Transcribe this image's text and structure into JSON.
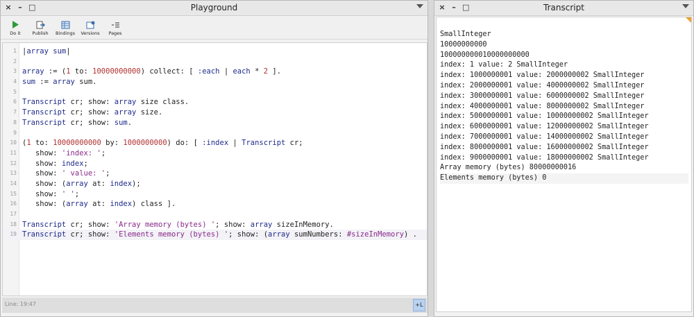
{
  "playground": {
    "title": "Playground",
    "controls": {
      "close": "×",
      "minimize": "–",
      "maximize": "□"
    },
    "toolbar": [
      {
        "label": "Do it",
        "icon": "play-icon"
      },
      {
        "label": "Publish",
        "icon": "publish-icon"
      },
      {
        "label": "Bindings",
        "icon": "bindings-icon"
      },
      {
        "label": "Versions",
        "icon": "versions-icon"
      },
      {
        "label": "Pages",
        "icon": "pages-icon"
      }
    ],
    "line_numbers": [
      "1",
      "2",
      "3",
      "4",
      "5",
      "6",
      "7",
      "8",
      "9",
      "10",
      "11",
      "12",
      "13",
      "14",
      "15",
      "16",
      "17",
      "18",
      "19"
    ],
    "status": {
      "position": "Line: 19:47",
      "toggle": "+L"
    }
  },
  "transcript": {
    "title": "Transcript",
    "controls": {
      "close": "×",
      "minimize": "–",
      "maximize": "□"
    },
    "lines": [
      "SmallInteger",
      "10000000000",
      "100000000010000000000",
      "index: 1 value: 2 SmallInteger",
      "index: 1000000001 value: 2000000002 SmallInteger",
      "index: 2000000001 value: 4000000002 SmallInteger",
      "index: 3000000001 value: 6000000002 SmallInteger",
      "index: 4000000001 value: 8000000002 SmallInteger",
      "index: 5000000001 value: 10000000002 SmallInteger",
      "index: 6000000001 value: 12000000002 SmallInteger",
      "index: 7000000001 value: 14000000002 SmallInteger",
      "index: 8000000001 value: 16000000002 SmallInteger",
      "index: 9000000001 value: 18000000002 SmallInteger",
      "Array memory (bytes) 80000000016",
      "Elements memory (bytes) 0"
    ]
  },
  "code": {
    "l1": {
      "a": "|",
      "b": "array sum",
      "c": "|"
    },
    "l3": {
      "a": "array",
      "b": " := (",
      "c": "1",
      "d": " to: ",
      "e": "10000000000",
      "f": ") collect: [ ",
      "g": ":each",
      "h": " | ",
      "i": "each",
      "j": " * ",
      "k": "2",
      "l": " ]."
    },
    "l4": {
      "a": "sum",
      "b": " := ",
      "c": "array",
      "d": " sum."
    },
    "l6": {
      "a": "Transcript",
      "b": " cr; show: ",
      "c": "array",
      "d": " size class."
    },
    "l7": {
      "a": "Transcript",
      "b": " cr; show: ",
      "c": "array",
      "d": " size."
    },
    "l8": {
      "a": "Transcript",
      "b": " cr; show: ",
      "c": "sum",
      "d": "."
    },
    "l10": {
      "a": "(",
      "b": "1",
      "c": " to: ",
      "d": "10000000000",
      "e": " by: ",
      "f": "1000000000",
      "g": ") do: [ ",
      "h": ":index",
      "i": " | ",
      "j": "Transcript",
      "k": " cr;"
    },
    "l11": {
      "a": "   show: ",
      "b": "'index: '",
      "c": ";"
    },
    "l12": {
      "a": "   show: ",
      "b": "index",
      "c": ";"
    },
    "l13": {
      "a": "   show: ",
      "b": "' value: '",
      "c": ";"
    },
    "l14": {
      "a": "   show: (",
      "b": "array",
      "c": " at: ",
      "d": "index",
      "e": ");"
    },
    "l15": {
      "a": "   show: ",
      "b": "' '",
      "c": ";"
    },
    "l16": {
      "a": "   show: (",
      "b": "array",
      "c": " at: ",
      "d": "index",
      "e": ") class ]."
    },
    "l18": {
      "a": "Transcript",
      "b": " cr; show: ",
      "c": "'Array memory (bytes) '",
      "d": "; show: ",
      "e": "array",
      "f": " sizeInMemory."
    },
    "l19": {
      "a": "Transcript",
      "b": " cr; show: ",
      "c": "'Elements memory (bytes) '",
      "d": "; show: (",
      "e": "array",
      "f": " sumNumbers: ",
      "g": "#sizeInMemory",
      "h": ") ."
    }
  },
  "colors": {
    "variable": "#1e2a8a",
    "number": "#b03030",
    "string": "#8a2a8a",
    "play_green": "#2e9a3a",
    "accent_blue": "#3a6fb0",
    "transcript_corner": "#f0a030"
  }
}
